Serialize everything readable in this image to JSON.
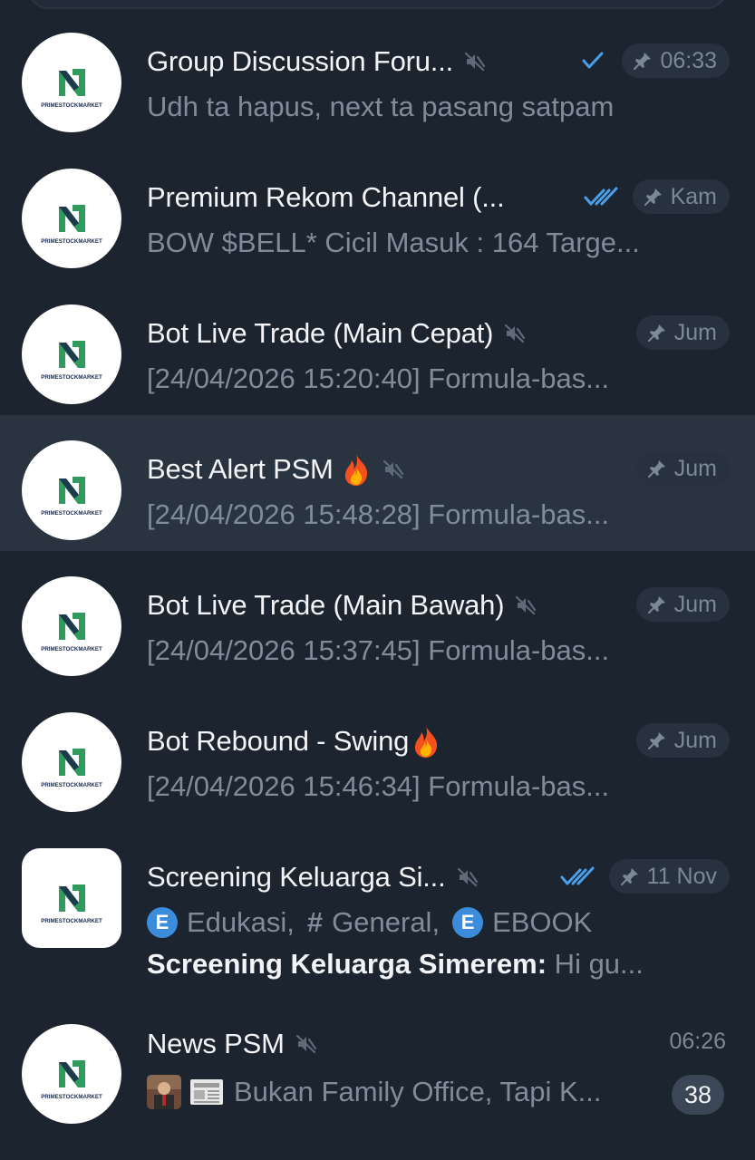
{
  "colors": {
    "background": "#1c2430",
    "selected_row": "#2a3440",
    "title_text": "#f2f4f7",
    "secondary_text": "#818c9a",
    "check_blue": "#4a9fe8",
    "pill_bg": "#273140",
    "topic_badge": "#3b8cdb",
    "unread_badge": "#3b4656",
    "avatar_logo_green": "#2f9c5d",
    "avatar_logo_navy": "#1a2a4a"
  },
  "avatar": {
    "logo_text": "PRIMESTOCKMARKET"
  },
  "chats": [
    {
      "title": "Group Discussion Foru...",
      "muted": true,
      "status_icon": "single-check-icon",
      "pinned": true,
      "time": "06:33",
      "preview": "Udh ta hapus, next ta pasang satpam"
    },
    {
      "title": "Premium Rekom Channel (...",
      "muted": false,
      "status_icon": "double-check-icon",
      "pinned": true,
      "time": "Kam",
      "preview": "BOW $BELL*  Cicil Masuk : 164 Targe..."
    },
    {
      "title": "Bot Live Trade (Main Cepat)",
      "muted": true,
      "pinned": true,
      "time": "Jum",
      "preview": "[24/04/2026 15:20:40] Formula-bas..."
    },
    {
      "title": "Best Alert PSM",
      "emoji": "fire-emoji",
      "muted": true,
      "pinned": true,
      "time": "Jum",
      "preview": "[24/04/2026 15:48:28] Formula-bas...",
      "selected": true
    },
    {
      "title": "Bot Live Trade (Main Bawah)",
      "muted": true,
      "pinned": true,
      "time": "Jum",
      "preview": "[24/04/2026 15:37:45] Formula-bas..."
    },
    {
      "title": "Bot Rebound - Swing",
      "emoji": "fire-emoji",
      "muted": false,
      "pinned": true,
      "time": "Jum",
      "preview": "[24/04/2026 15:46:34] Formula-bas..."
    },
    {
      "title": "Screening Keluarga Si...",
      "muted": true,
      "status_icon": "double-check-icon",
      "pinned": true,
      "time": "11 Nov",
      "topics": [
        {
          "icon": "E",
          "label": "Edukasi,"
        },
        {
          "icon": "#",
          "label": "General,"
        },
        {
          "icon": "E",
          "label": "EBOOK"
        }
      ],
      "sender": "Screening Keluarga Simerem:",
      "sub_preview": " Hi gu..."
    },
    {
      "title": "News PSM",
      "muted": true,
      "pinned": false,
      "time": "06:26",
      "preview": "Bukan Family Office, Tapi K...",
      "unread": "38"
    }
  ]
}
